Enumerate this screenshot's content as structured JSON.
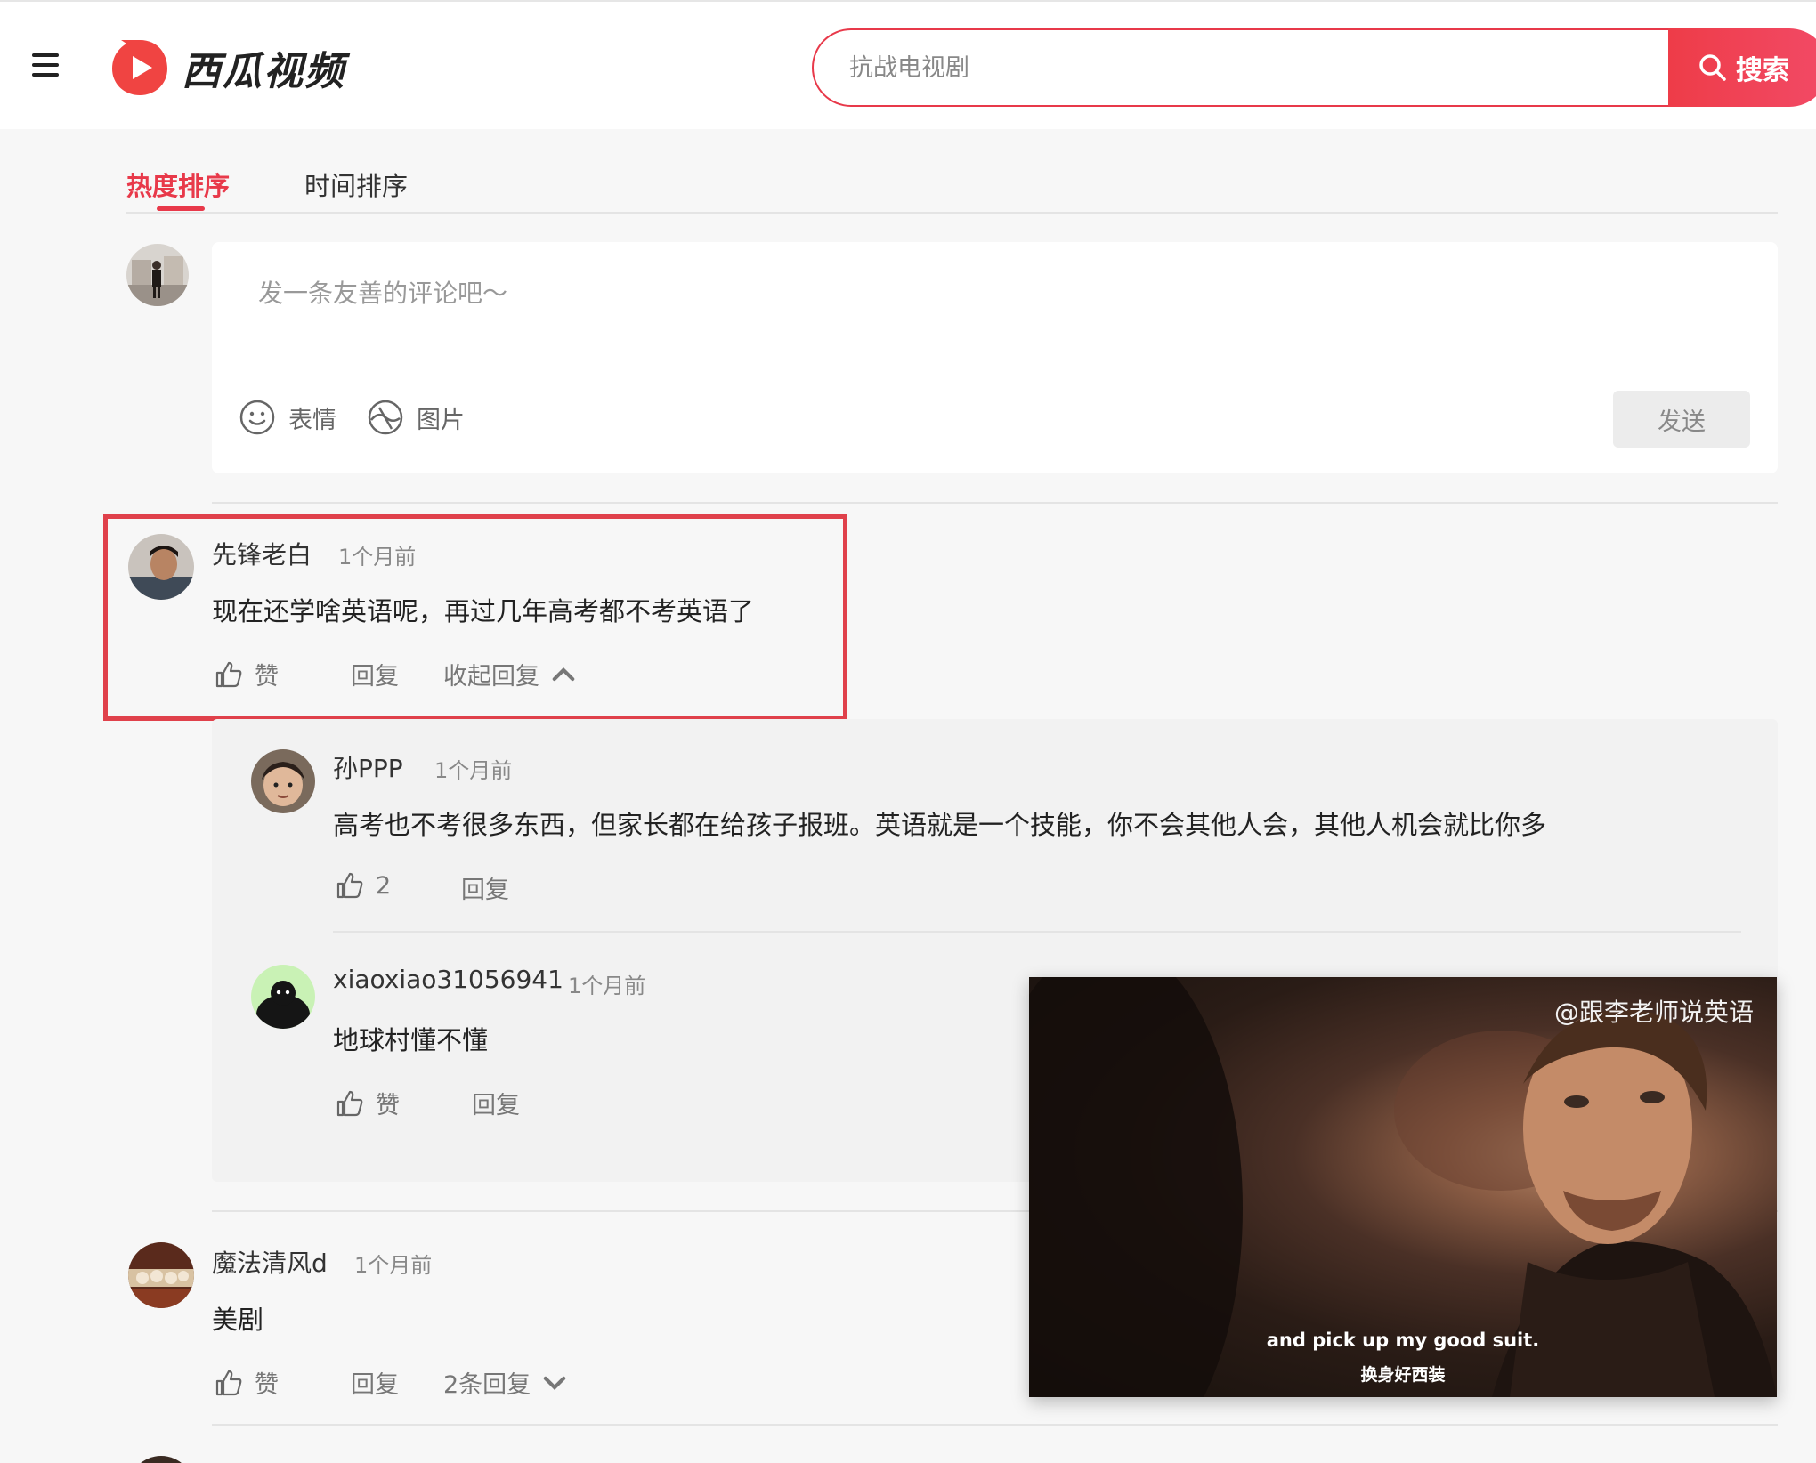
{
  "header": {
    "logo_text": "西瓜视频",
    "search_placeholder": "抗战电视剧",
    "search_button": "搜索"
  },
  "tabs": [
    {
      "label": "热度排序",
      "active": true
    },
    {
      "label": "时间排序",
      "active": false
    }
  ],
  "composer": {
    "placeholder": "发一条友善的评论吧～",
    "emoji_label": "表情",
    "image_label": "图片",
    "send_label": "发送"
  },
  "comments": [
    {
      "user": "先锋老白",
      "time": "1个月前",
      "text": "现在还学啥英语呢，再过几年高考都不考英语了",
      "like_label": "赞",
      "reply_label": "回复",
      "toggle_label": "收起回复",
      "replies": [
        {
          "user": "孙PPP",
          "time": "1个月前",
          "text": "高考也不考很多东西，但家长都在给孩子报班。英语就是一个技能，你不会其他人会，其他人机会就比你多",
          "like_label": "2",
          "reply_label": "回复"
        },
        {
          "user": "xiaoxiao31056941",
          "time": "1个月前",
          "text": "地球村懂不懂",
          "like_label": "赞",
          "reply_label": "回复"
        }
      ]
    },
    {
      "user": "魔法清风d",
      "time": "1个月前",
      "text": "美剧",
      "like_label": "赞",
      "reply_label": "回复",
      "toggle_label": "2条回复"
    }
  ],
  "video": {
    "watermark": "@跟李老师说英语",
    "subtitle_en": "and pick up my good suit.",
    "subtitle_zh": "换身好西装"
  },
  "colors": {
    "accent": "#e8394a",
    "highlight_box": "#e0414b",
    "background": "#f7f7f7"
  }
}
